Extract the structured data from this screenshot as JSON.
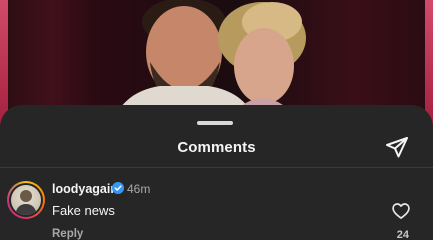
{
  "sheet": {
    "title": "Comments",
    "share_icon": "paper-plane-icon"
  },
  "comments": [
    {
      "username": "loodyagain",
      "verified": true,
      "time": "46m",
      "text": "Fake news",
      "reply_label": "Reply",
      "like_icon": "heart-outline-icon",
      "like_count": "24"
    }
  ],
  "colors": {
    "sheet_background": "#262626",
    "text_primary": "#f5f5f5",
    "text_secondary": "#a8a8a8",
    "verified_blue": "#3797f0"
  }
}
